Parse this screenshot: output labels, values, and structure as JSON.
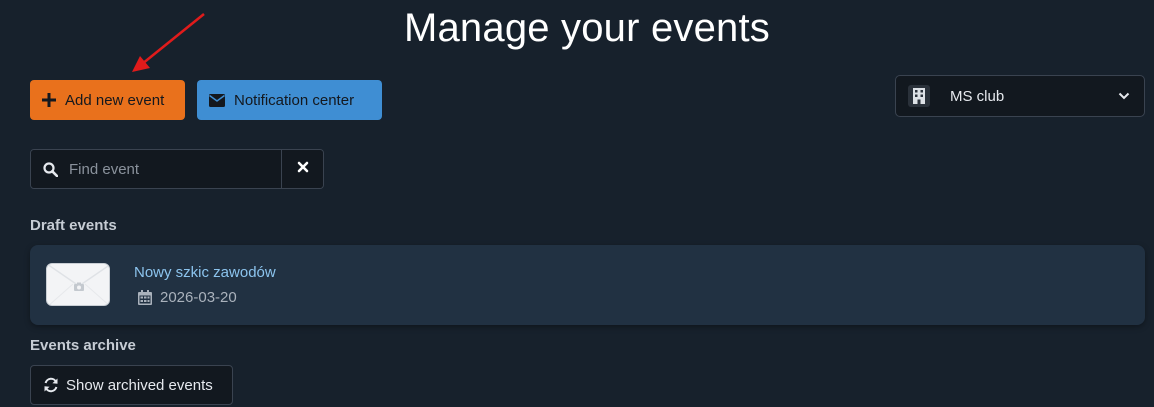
{
  "header": {
    "title": "Manage your events"
  },
  "toolbar": {
    "add_event_label": "Add new event",
    "notification_center_label": "Notification center"
  },
  "club_select": {
    "selected": "MS club"
  },
  "search": {
    "placeholder": "Find event",
    "value": ""
  },
  "draft_section": {
    "heading": "Draft events",
    "events": [
      {
        "name": "Nowy szkic zawodów",
        "date": "2026-03-20"
      }
    ]
  },
  "archive_section": {
    "heading": "Events archive",
    "show_archived_label": "Show archived events"
  },
  "colors": {
    "background": "#17212c",
    "add_button": "#e9711c",
    "notification_button": "#3f8ed3",
    "card": "#213142",
    "link": "#8cc4ee",
    "annotation_arrow": "#e01b1b"
  },
  "icons": {
    "add": "plus-icon",
    "notification": "envelope-icon",
    "club": "building-icon",
    "dropdown": "chevron-down-icon",
    "search": "search-icon",
    "clear": "close-icon",
    "thumbnail": "camera-icon",
    "date": "calendar-icon",
    "archive": "refresh-icon"
  }
}
